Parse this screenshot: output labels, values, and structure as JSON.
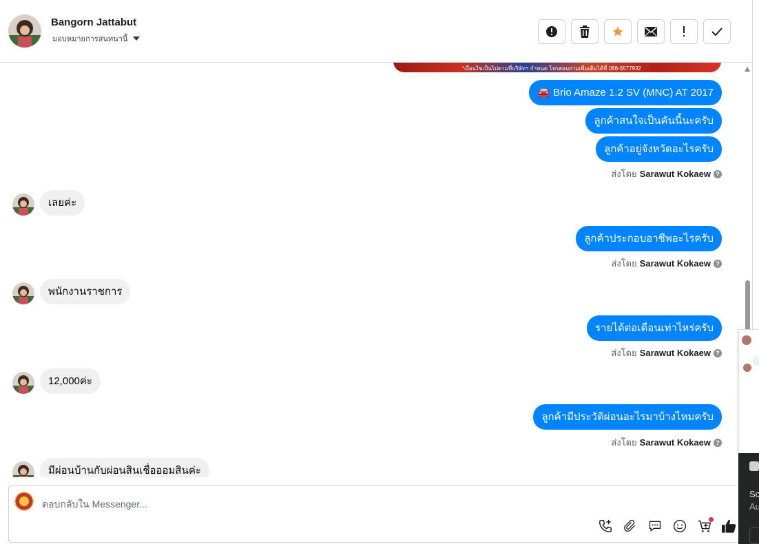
{
  "header": {
    "contact_name": "Bangorn Jattabut",
    "assign_label": "มอบหมายการสนทนานี้",
    "toolbar": [
      {
        "name": "spam-button",
        "icon": "exclamation-circle-icon"
      },
      {
        "name": "delete-button",
        "icon": "trash-icon"
      },
      {
        "name": "star-button",
        "icon": "star-icon",
        "color": "#f7923b"
      },
      {
        "name": "mark-unread-button",
        "icon": "envelope-icon"
      },
      {
        "name": "follow-up-button",
        "icon": "exclamation-icon"
      },
      {
        "name": "done-button",
        "icon": "check-icon"
      }
    ]
  },
  "banner": {
    "caption": "*เงื่อนไขเป็นไปตามที่บริษัทฯ กำหนด โทรสอบถามเพิ่มเติมได้ที่ 088-6577932"
  },
  "messages": {
    "m1": "🚘 Brio Amaze 1.2 SV (MNC) AT 2017",
    "m2": "ลูกค้าสนใจเป็นคันนี้นะครับ",
    "m3": "ลูกค้าอยู่จังหวัดอะไรครับ",
    "m4": "เลยค่ะ",
    "m5": "ลูกค้าประกอบอาชีพอะไรครับ",
    "m6": "พนักงานราชการ",
    "m7": "รายได้ต่อเดือนเท่าไหร่ครับ",
    "m8": "12,000ค่ะ",
    "m9": "ลูกค้ามีประวัติผ่อนอะไรมาบ้างไหมครับ",
    "m10": "มีผ่อนบ้านกับผ่อนสินเชื่อออมสินค่ะ"
  },
  "sender": {
    "prefix": "ส่งโดย",
    "name": "Sarawut Kokaew",
    "help": "?"
  },
  "composer": {
    "placeholder": "ตอบกลับใน Messenger...",
    "actions": [
      "phone-add-icon",
      "paperclip-icon",
      "chat-bubble-icon",
      "emoji-icon",
      "cart-add-icon",
      "thumbs-up-icon"
    ],
    "like_color": "#050505",
    "badge_color": "#f02849"
  },
  "side_popup": {
    "toast_line1": "Sc",
    "toast_line2": "Au"
  },
  "colors": {
    "outgoing": "#0084ff",
    "incoming": "#f0f0f0"
  }
}
